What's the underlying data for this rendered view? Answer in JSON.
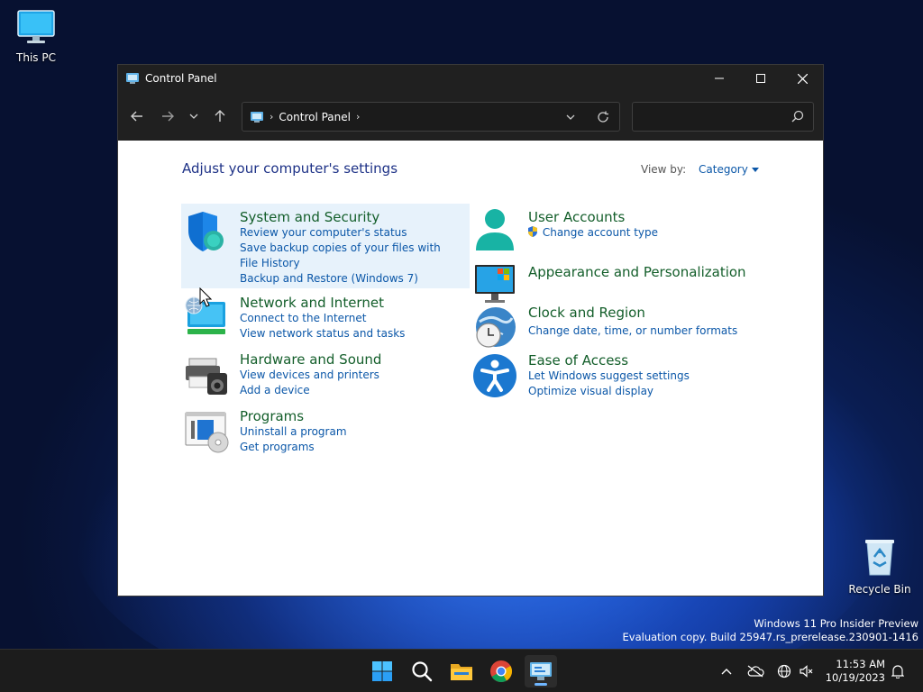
{
  "desktop": {
    "this_pc_label": "This PC",
    "recycle_bin_label": "Recycle Bin",
    "watermark_line1": "Windows 11 Pro Insider Preview",
    "watermark_line2": "Evaluation copy. Build 25947.rs_prerelease.230901-1416"
  },
  "window": {
    "title": "Control Panel",
    "address_crumb": "Control Panel",
    "search_placeholder": ""
  },
  "content": {
    "heading": "Adjust your computer's settings",
    "view_by_label": "View by:",
    "view_by_value": "Category",
    "categories": [
      {
        "title": "System and Security",
        "links": [
          "Review your computer's status",
          "Save backup copies of your files with File History",
          "Backup and Restore (Windows 7)"
        ]
      },
      {
        "title": "Network and Internet",
        "links": [
          "Connect to the Internet",
          "View network status and tasks"
        ]
      },
      {
        "title": "Hardware and Sound",
        "links": [
          "View devices and printers",
          "Add a device"
        ]
      },
      {
        "title": "Programs",
        "links": [
          "Uninstall a program",
          "Get programs"
        ]
      },
      {
        "title": "User Accounts",
        "links": [
          "Change account type"
        ]
      },
      {
        "title": "Appearance and Personalization",
        "links": []
      },
      {
        "title": "Clock and Region",
        "links": [
          "Change date, time, or number formats"
        ]
      },
      {
        "title": "Ease of Access",
        "links": [
          "Let Windows suggest settings",
          "Optimize visual display"
        ]
      }
    ]
  },
  "taskbar": {
    "time": "11:53 AM",
    "date": "10/19/2023",
    "apps": [
      "windows-start-icon",
      "search-icon",
      "file-explorer-icon",
      "chrome-icon",
      "control-panel-icon"
    ]
  },
  "colors": {
    "category_title": "#135e2a",
    "link": "#0b57a8",
    "heading": "#1e3287",
    "highlight": "#e7f2fb"
  }
}
